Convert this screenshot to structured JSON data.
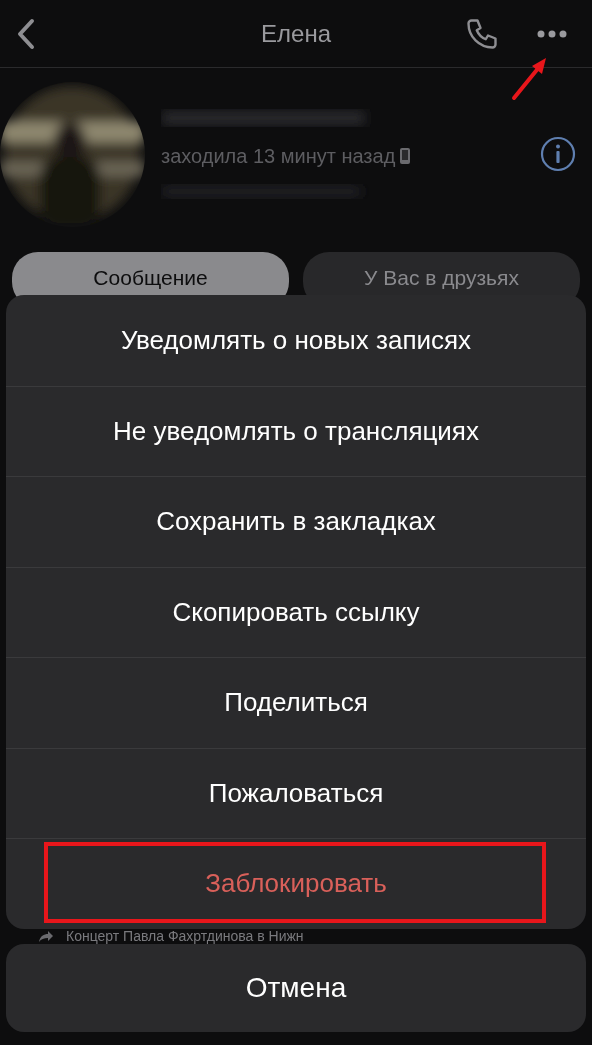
{
  "header": {
    "title": "Елена"
  },
  "profile": {
    "status": "заходила 13 минут назад"
  },
  "buttons": [
    {
      "label": "Сообщение",
      "kind": "primary"
    },
    {
      "label": "У Вас в друзьях",
      "kind": "secondary"
    }
  ],
  "background_post": {
    "text": "Концерт Павла Фахртдинова в Нижн"
  },
  "menu": [
    {
      "label": "Уведомлять о новых записях",
      "kind": "normal",
      "highlighted": false
    },
    {
      "label": "Не уведомлять о трансляциях",
      "kind": "normal",
      "highlighted": false
    },
    {
      "label": "Сохранить в закладках",
      "kind": "normal",
      "highlighted": false
    },
    {
      "label": "Скопировать ссылку",
      "kind": "normal",
      "highlighted": false
    },
    {
      "label": "Поделиться",
      "kind": "normal",
      "highlighted": false
    },
    {
      "label": "Пожаловаться",
      "kind": "normal",
      "highlighted": false
    },
    {
      "label": "Заблокировать",
      "kind": "destructive",
      "highlighted": true
    }
  ],
  "cancel": {
    "label": "Отмена"
  }
}
